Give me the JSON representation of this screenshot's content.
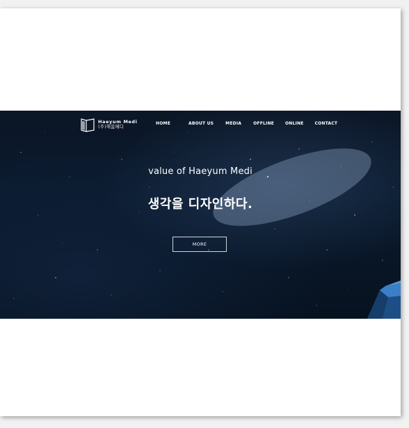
{
  "site": {
    "logo_name_en": "Haeyum Medi",
    "logo_name_ko": "(주)해움메디"
  },
  "nav": {
    "items": [
      {
        "label": "HOME"
      },
      {
        "label": "ABOUT US"
      },
      {
        "label": "MEDIA"
      },
      {
        "label": "OFFLINE"
      },
      {
        "label": "ONLINE"
      },
      {
        "label": "CONTACT"
      }
    ]
  },
  "hero": {
    "subtitle": "value of Haeyum Medi",
    "title": "생각을 디자인하다.",
    "button_label": "MORE"
  },
  "colors": {
    "hero_background": "#0a1a2e",
    "text": "#ffffff",
    "button_border": "#cfd6df",
    "tent": "#2a6ab0"
  },
  "icons": {
    "logo": "book-logo-icon"
  }
}
